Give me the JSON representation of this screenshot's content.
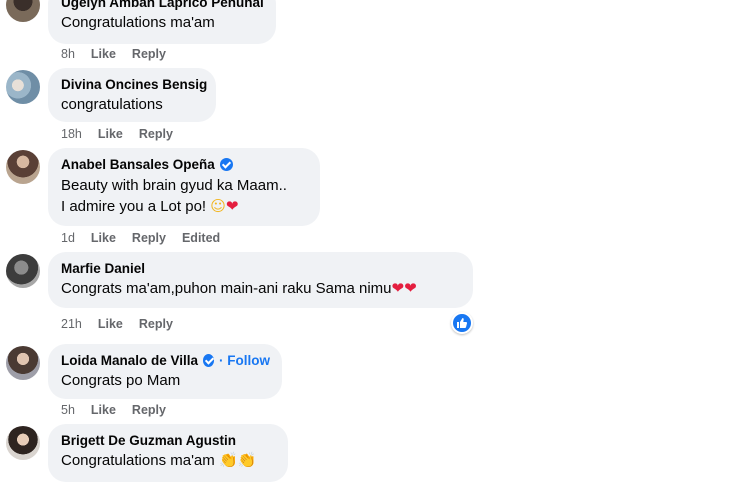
{
  "comments": [
    {
      "author": "Ugelyn Amban Laprico Penunal",
      "text": "Congratulations ma'am",
      "time": "8h",
      "like": "Like",
      "reply": "Reply"
    },
    {
      "author": "Divina Oncines Bensig",
      "text": "congratulations",
      "time": "18h",
      "like": "Like",
      "reply": "Reply"
    },
    {
      "author": "Anabel Bansales Opeña",
      "text_line1": "Beauty with brain gyud ka Maam..",
      "text_line2": "I admire you a Lot po!",
      "time": "1d",
      "like": "Like",
      "reply": "Reply",
      "edited": "Edited"
    },
    {
      "author": "Marfie Daniel",
      "text": "Congrats ma'am,puhon main-ani raku Sama nimu",
      "time": "21h",
      "like": "Like",
      "reply": "Reply"
    },
    {
      "author": "Loida Manalo de Villa",
      "follow": "· Follow",
      "text": "Congrats po Mam",
      "time": "5h",
      "like": "Like",
      "reply": "Reply"
    },
    {
      "author": "Brigett De Guzman Agustin",
      "text": "Congratulations ma'am"
    }
  ],
  "icons": {
    "verified": "verified-badge-icon",
    "like_reaction": "like-reaction-icon",
    "heart": "heart-emoji",
    "smile": "smiling-face-emoji",
    "clap": "clapping-hands-emoji"
  },
  "colors": {
    "accent": "#1877f2",
    "bubble": "#f0f2f5",
    "meta": "#65676b",
    "heart": "#e41e3f"
  }
}
